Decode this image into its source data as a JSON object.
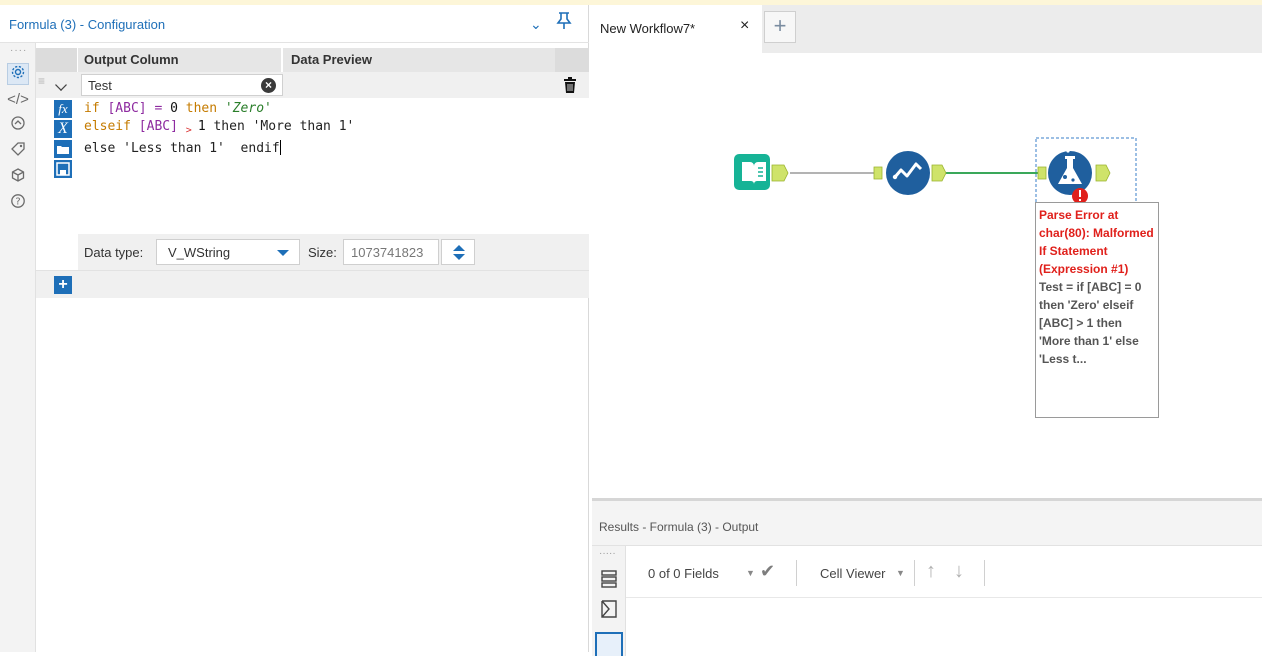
{
  "config": {
    "title": "Formula (3) - Configuration",
    "col_output": "Output Column",
    "col_preview": "Data Preview",
    "field_name": "Test",
    "expression": {
      "line1": {
        "if": "if",
        "field": "[ABC]",
        "op": " = ",
        "num": "0",
        "then": " then ",
        "str": "'Zero'"
      },
      "line2": {
        "elseif": "elseif",
        "field": " [ABC] ",
        "op": "> ",
        "num": "1",
        "then": " then ",
        "str": "'More than 1'"
      },
      "line3": {
        "else": "else ",
        "str": "'Less than 1'",
        "endif": "  endif"
      }
    },
    "data_type_label": "Data type:",
    "data_type_value": "V_WString",
    "size_label": "Size:",
    "size_value": "1073741823",
    "add_label": "+"
  },
  "tabs": {
    "active": "New Workflow7*",
    "close": "×",
    "add": "+"
  },
  "tool_error": {
    "title": "Parse Error at char(80): Malformed If Statement (Expression #1)",
    "body": "Test = if [ABC] = 0 then 'Zero' elseif [ABC] > 1 then 'More than 1' else 'Less t..."
  },
  "results": {
    "title": "Results - Formula (3) - Output",
    "fields": "0 of 0 Fields",
    "viewer": "Cell Viewer"
  },
  "icons": [
    "gear-icon",
    "code-icon",
    "dots-circle-icon",
    "tag-icon",
    "cube-icon",
    "help-icon",
    "trash-icon",
    "function-icon",
    "variable-icon",
    "folder-icon",
    "save-icon",
    "input-book-icon",
    "check-flow-icon",
    "formula-flask-icon",
    "error-badge-icon"
  ],
  "colors": {
    "accent": "#1e6fb8",
    "error": "#e0201b",
    "connector": "#cfe36a",
    "teal": "#16b396"
  }
}
